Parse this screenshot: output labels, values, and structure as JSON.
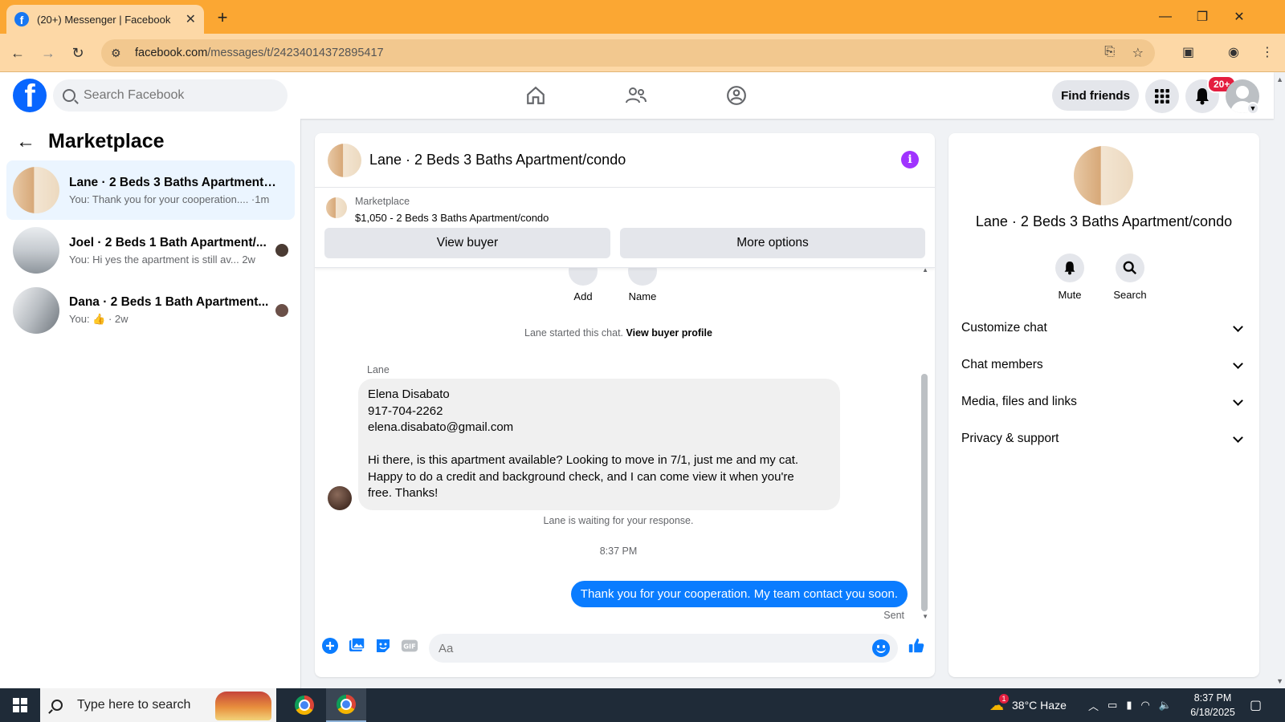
{
  "browser": {
    "tab_title": "(20+) Messenger | Facebook",
    "tab_favicon": "f",
    "url_host": "facebook.com",
    "url_path": "/messages/t/24234014372895417"
  },
  "fb_header": {
    "logo": "f",
    "search_placeholder": "Search Facebook",
    "find_friends_label": "Find friends",
    "notifications_badge": "20+"
  },
  "sidebar": {
    "title": "Marketplace",
    "conversations": [
      {
        "name": "Lane · 2 Beds 3 Baths Apartment/c...",
        "preview": "You: Thank you for your cooperation.... ·1m",
        "active": true
      },
      {
        "name": "Joel · 2 Beds 1 Bath Apartment/...",
        "preview": "You: Hi yes the apartment is still av...  2w",
        "active": false
      },
      {
        "name": "Dana · 2 Beds 1 Bath Apartment...",
        "preview": "You: 👍 · 2w",
        "active": false
      }
    ]
  },
  "chat": {
    "title": "Lane · 2 Beds 3 Baths Apartment/condo",
    "marketplace_label": "Marketplace",
    "listing": "$1,050 - 2 Beds 3 Baths Apartment/condo",
    "view_buyer_label": "View buyer",
    "more_options_label": "More options",
    "add_label": "Add",
    "name_label": "Name",
    "started_text": "Lane started this chat.",
    "view_profile_label": "View buyer profile",
    "sender": "Lane",
    "incoming_lines": [
      "Elena Disabato",
      "917-704-2262",
      "elena.disabato@gmail.com",
      "",
      "Hi there, is this apartment available? Looking to move in 7/1, just me and my cat.",
      "Happy to do a credit and background check, and I can come view it when you're",
      "free. Thanks!"
    ],
    "waiting_text": "Lane is waiting for your response.",
    "timestamp": "8:37 PM",
    "outgoing": "Thank you for your cooperation. My team contact you soon.",
    "sent_label": "Sent",
    "composer_placeholder": "Aa"
  },
  "details": {
    "name": "Lane · 2 Beds 3 Baths Apartment/condo",
    "mute_label": "Mute",
    "search_label": "Search",
    "sections": [
      "Customize chat",
      "Chat members",
      "Media, files and links",
      "Privacy & support"
    ]
  },
  "taskbar": {
    "search_placeholder": "Type here to search",
    "weather": "38°C  Haze",
    "weather_badge": "1",
    "time": "8:37 PM",
    "date": "6/18/2025"
  },
  "colors": {
    "brand": "#0866ff",
    "outgoing_bubble": "#0a7cff",
    "browser_frame": "#fba733",
    "info_icon": "#a033ff"
  }
}
